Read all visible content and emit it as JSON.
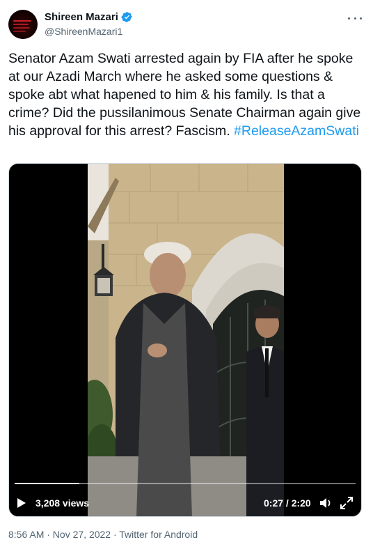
{
  "author": {
    "name": "Shireen Mazari",
    "handle": "@ShireenMazari1",
    "verified": true
  },
  "tweet": {
    "text": "Senator Azam Swati arrested again by FIA after he spoke at our Azadi March where he asked some questions & spoke abt what hapened to him & his family. Is that a crime? Did the pussilanimous Senate Chairman again give his approval for this arrest? Fascism.",
    "hashtag": "#ReleaseAzamSwati",
    "timestamp": "8:56 AM · Nov 27, 2022 · Twitter for Android"
  },
  "video": {
    "views": "3,208 views",
    "time": "0:27 / 2:20",
    "progress": 0.19
  },
  "colors": {
    "link": "#1d9bf0",
    "text": "#0f1419",
    "secondary": "#536471"
  },
  "icons": [
    "verified-badge-icon",
    "more-options-icon",
    "play-icon",
    "volume-icon",
    "fullscreen-icon"
  ]
}
